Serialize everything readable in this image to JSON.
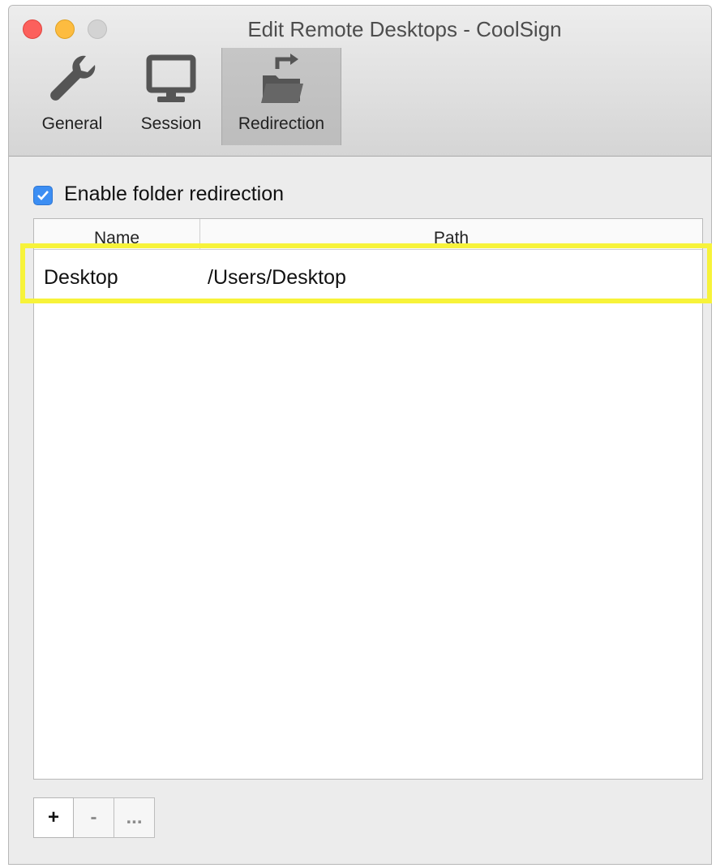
{
  "window": {
    "title": "Edit Remote Desktops - CoolSign"
  },
  "toolbar": {
    "tabs": [
      {
        "label": "General",
        "icon": "wrench-icon",
        "selected": false
      },
      {
        "label": "Session",
        "icon": "monitor-icon",
        "selected": false
      },
      {
        "label": "Redirection",
        "icon": "folder-redirect-icon",
        "selected": true
      }
    ]
  },
  "redirection": {
    "enable_label": "Enable folder redirection",
    "enable_checked": true,
    "columns": [
      "Name",
      "Path"
    ],
    "rows": [
      {
        "name": "Desktop",
        "path": "/Users/Desktop"
      }
    ],
    "buttons": {
      "add": "+",
      "remove": "-",
      "more": "..."
    }
  },
  "colors": {
    "accent": "#3c8ef3",
    "highlight": "#f7f33a",
    "close": "#fc605c",
    "minimize": "#fdbc40"
  }
}
